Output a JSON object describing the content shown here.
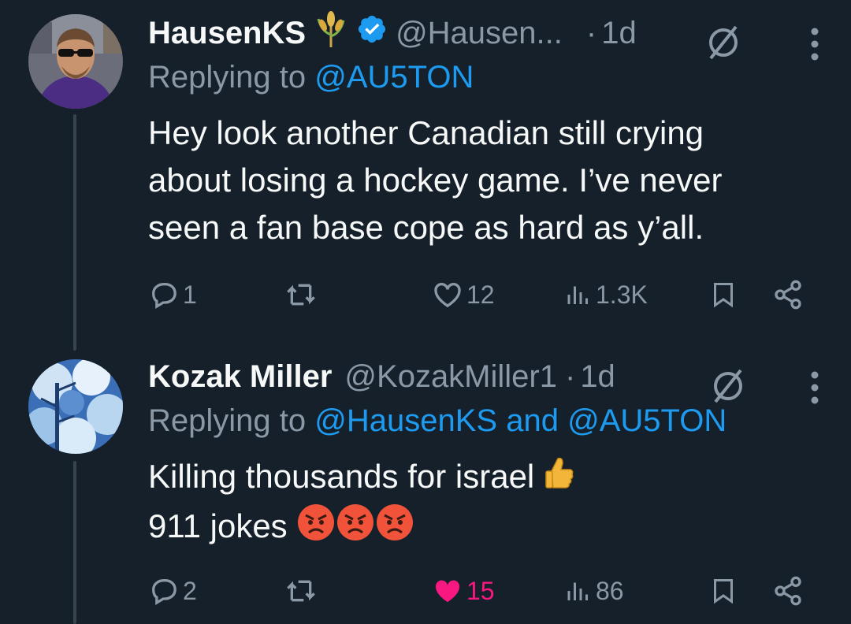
{
  "colors": {
    "background": "#15202b",
    "text_primary": "#f7f9f9",
    "text_secondary": "#8b98a5",
    "accent": "#1d9bf0",
    "like": "#f91880",
    "thread_line": "#38444d"
  },
  "tweets": [
    {
      "display_name": "HausenKS",
      "badge_icon": "wheat-icon",
      "verified_icon": "verified-badge-icon",
      "handle": "@Hausen...",
      "dot": "·",
      "time": "1d",
      "replying_prefix": "Replying to",
      "replying_to": "@AU5TON",
      "replying_and": "",
      "replying_to_2": "",
      "text_lines": [
        "Hey look another Canadian still crying",
        "about losing a hockey game. I’ve never",
        "seen a fan base cope as hard as y’all."
      ],
      "replies": "1",
      "retweets": "",
      "likes": "12",
      "views": "1.3K",
      "liked": false
    },
    {
      "display_name": "Kozak Miller",
      "handle": "@KozakMiller1",
      "dot": "·",
      "time": "1d",
      "replying_prefix": "Replying to",
      "replying_to": "@HausenKS",
      "replying_and": "and",
      "replying_to_2": "@AU5TON",
      "text_lines": [
        "Killing thousands for israel",
        "911 jokes"
      ],
      "line1_emoji": "thumbs-up-emoji",
      "line2_emojis": [
        "angry-face-emoji",
        "angry-face-emoji",
        "angry-face-emoji"
      ],
      "replies": "2",
      "retweets": "",
      "likes": "15",
      "views": "86",
      "liked": true
    }
  ]
}
